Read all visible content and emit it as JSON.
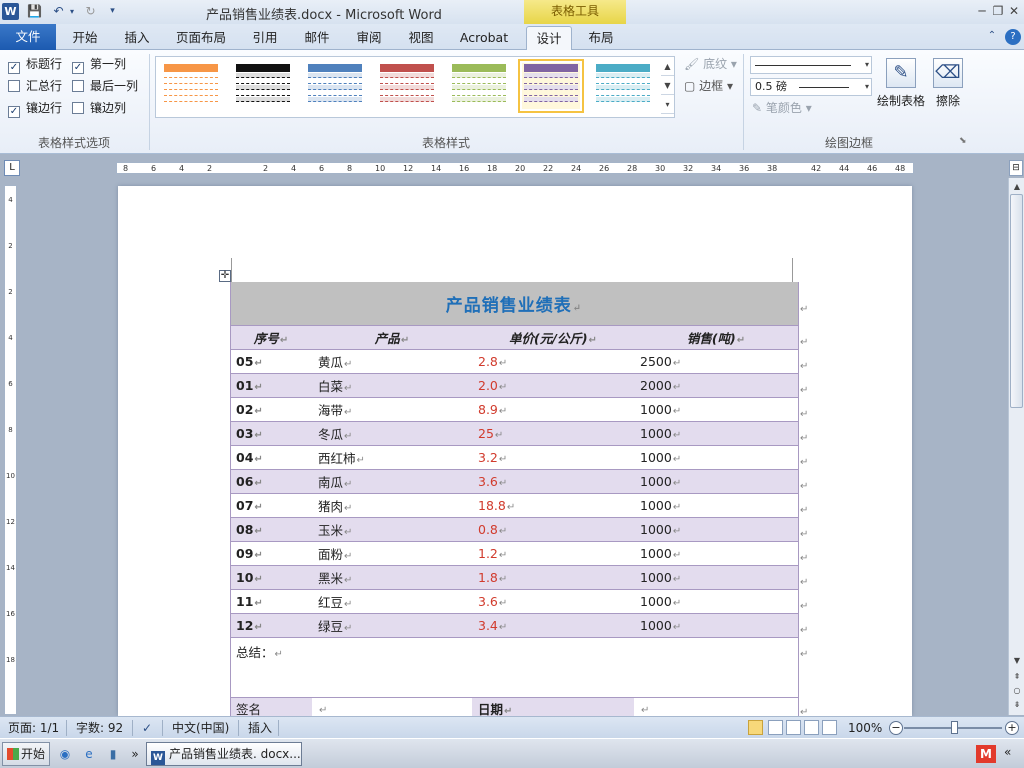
{
  "window": {
    "title": "产品销售业绩表.docx - Microsoft Word",
    "contextual_tab": "表格工具",
    "word_logo": "W",
    "save_glyph": "💾",
    "undo_glyph": "↶",
    "undo_drop_glyph": "▾",
    "redo_glyph": "↻",
    "qa_custom_glyph": "▾",
    "min_glyph": "─",
    "restore_glyph": "❐",
    "close_glyph": "✕"
  },
  "tabs": {
    "file": "文件",
    "home": "开始",
    "insert": "插入",
    "page_layout": "页面布局",
    "references": "引用",
    "mailings": "邮件",
    "review": "审阅",
    "view": "视图",
    "acrobat": "Acrobat",
    "design": "设计",
    "layout": "布局",
    "collapse_glyph": "⌃",
    "help_glyph": "?"
  },
  "ribbon": {
    "options": {
      "header_row": "标题行",
      "first_column": "第一列",
      "total_row": "汇总行",
      "last_column": "最后一列",
      "banded_rows": "镶边行",
      "banded_columns": "镶边列",
      "checked_glyph": "✓",
      "group_label": "表格样式选项"
    },
    "styles": {
      "group_label": "表格样式",
      "shading": "底纹",
      "borders": "边框",
      "scroll_up_glyph": "▲",
      "scroll_down_glyph": "▼",
      "more_glyph": "▾",
      "shading_glyph": "🖌",
      "borders_glyph": "▢"
    },
    "draw": {
      "line_weight": "0.5 磅",
      "pen_color": "笔颜色",
      "draw_table": "绘制表格",
      "eraser": "擦除",
      "group_label": "绘图边框",
      "draw_glyph": "✎",
      "eraser_glyph": "⌫",
      "pen_glyph": "✎",
      "launcher_glyph": "⬊"
    }
  },
  "ruler": {
    "corner_glyph": "L",
    "toggle_glyph": "⊟",
    "h_ticks": [
      "8",
      "6",
      "4",
      "2",
      "2",
      "4",
      "6",
      "8",
      "10",
      "12",
      "14",
      "16",
      "18",
      "20",
      "22",
      "24",
      "26",
      "28",
      "30",
      "32",
      "34",
      "36",
      "38",
      "42",
      "44",
      "46",
      "48"
    ],
    "v_ticks": [
      "4",
      "2",
      "2",
      "4",
      "6",
      "8",
      "10",
      "12",
      "14",
      "16",
      "18"
    ]
  },
  "document": {
    "table_title": "产品销售业绩表",
    "headers": [
      "序号",
      "产品",
      "单价(元/公斤)",
      "销售(吨)"
    ],
    "rows": [
      {
        "id": "05",
        "product": "黄瓜",
        "price": "2.8",
        "sales": "2500"
      },
      {
        "id": "01",
        "product": "白菜",
        "price": "2.0",
        "sales": "2000"
      },
      {
        "id": "02",
        "product": "海带",
        "price": "8.9",
        "sales": "1000"
      },
      {
        "id": "03",
        "product": "冬瓜",
        "price": "25",
        "sales": "1000"
      },
      {
        "id": "04",
        "product": "西红柿",
        "price": "3.2",
        "sales": "1000"
      },
      {
        "id": "06",
        "product": "南瓜",
        "price": "3.6",
        "sales": "1000"
      },
      {
        "id": "07",
        "product": "猪肉",
        "price": "18.8",
        "sales": "1000"
      },
      {
        "id": "08",
        "product": "玉米",
        "price": "0.8",
        "sales": "1000"
      },
      {
        "id": "09",
        "product": "面粉",
        "price": "1.2",
        "sales": "1000"
      },
      {
        "id": "10",
        "product": "黑米",
        "price": "1.8",
        "sales": "1000"
      },
      {
        "id": "11",
        "product": "红豆",
        "price": "3.6",
        "sales": "1000"
      },
      {
        "id": "12",
        "product": "绿豆",
        "price": "3.4",
        "sales": "1000"
      }
    ],
    "summary_label": "总结：",
    "sign_label": "签名",
    "date_label": "日期",
    "paragraph_mark": "↵",
    "move_handle_glyph": "✛"
  },
  "statusbar": {
    "page": "页面: 1/1",
    "words": "字数: 92",
    "language": "中文(中国)",
    "insert_mode": "插入",
    "zoom": "100%",
    "zoom_minus": "−",
    "zoom_plus": "+",
    "proof_glyph": "✓"
  },
  "taskbar": {
    "start": "开始",
    "task_word": "产品销售业绩表. docx...",
    "tray_m": "M",
    "chevron": "«",
    "more_glyph": "»"
  },
  "scrollbar": {
    "up_glyph": "▲",
    "down_glyph": "▼",
    "prev_glyph": "⇞",
    "select_glyph": "○",
    "next_glyph": "⇟"
  },
  "colors": {
    "accent_blue": "#2b5797",
    "table_band": "#e3dcee",
    "table_title_bg": "#c0c0c0",
    "title_text": "#1f6fb8",
    "price_text": "#d13b2d"
  }
}
